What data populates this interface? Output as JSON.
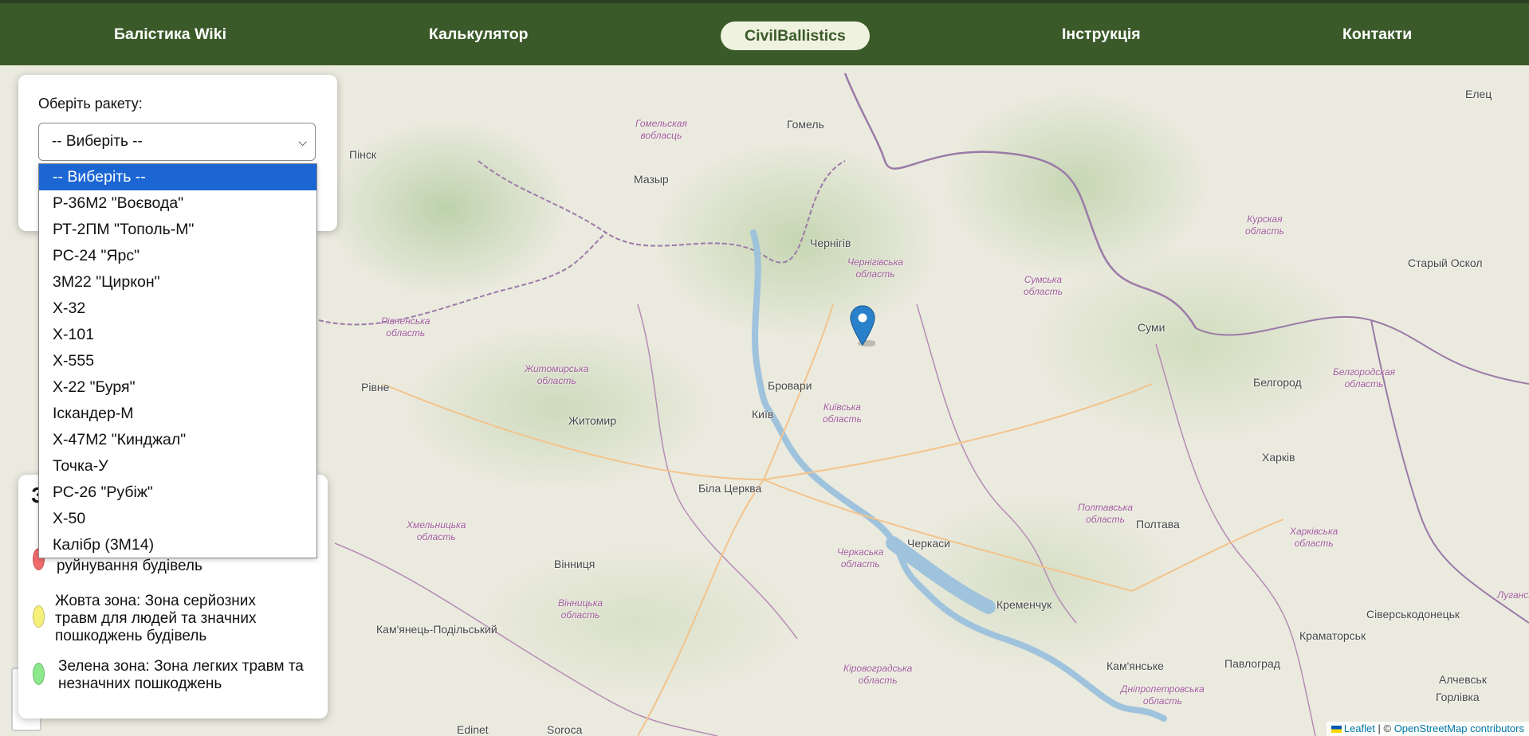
{
  "nav": {
    "items": [
      "Балістика Wiki",
      "Калькулятор",
      "CivilBallistics",
      "Інструкція",
      "Контакти"
    ],
    "active": "CivilBallistics"
  },
  "panel": {
    "label": "Оберіть ракету:",
    "selected": "-- Виберіть --",
    "options": [
      "-- Виберіть --",
      "Р-36М2 \"Воєвода\"",
      "РТ-2ПМ \"Тополь-М\"",
      "РС-24 \"Ярс\"",
      "3М22 \"Циркон\"",
      "Х-32",
      "Х-101",
      "Х-555",
      "Х-22 \"Буря\"",
      "Іскандер-М",
      "Х-47М2 \"Кинджал\"",
      "Точка-У",
      "РС-26 \"Рубіж\"",
      "Х-50",
      "Калібр (3М14)"
    ]
  },
  "legend": {
    "title": "З",
    "red_text": "ураження для людей та повного руйнування будівель",
    "yellow_text": "Жовта зона: Зона серйозних травм для людей та значних пошкоджень будівель",
    "green_text": "Зелена зона: Зона легких травм та незначних пошкоджень",
    "colors": {
      "red": "#f26b6b",
      "yellow": "#f5f07a",
      "green": "#8be88b"
    }
  },
  "map": {
    "cities": [
      "Гомель",
      "Мазыр",
      "Пінск",
      "Чернігів",
      "Суми",
      "Рівне",
      "Житомир",
      "Київ",
      "Бровари",
      "Біла Церква",
      "Черкаси",
      "Полтава",
      "Харків",
      "Белгород",
      "Кременчук",
      "Вінниця",
      "Кам'янське",
      "Павлоград",
      "Краматорськ",
      "Сіверськодонецьк",
      "Алчевськ",
      "Горлівка",
      "Старый Оскол",
      "Елец",
      "Кам'янець-Подільський",
      "Edinet",
      "Soroca"
    ],
    "regions": [
      "Гомельская вобласць",
      "Чернігівська область",
      "Сумська область",
      "Курская область",
      "Рівненська область",
      "Житомирська область",
      "Київська область",
      "Белгородская область",
      "Полтавська область",
      "Харківська область",
      "Хмельницька область",
      "Вінницька область",
      "Черкаська область",
      "Кіровоградська область",
      "Дніпропетровська область",
      "Луганська"
    ],
    "zoom_in": "+",
    "zoom_out": "−"
  },
  "attribution": {
    "leaflet": "Leaflet",
    "separator": " | © ",
    "osm": "OpenStreetMap contributors"
  }
}
